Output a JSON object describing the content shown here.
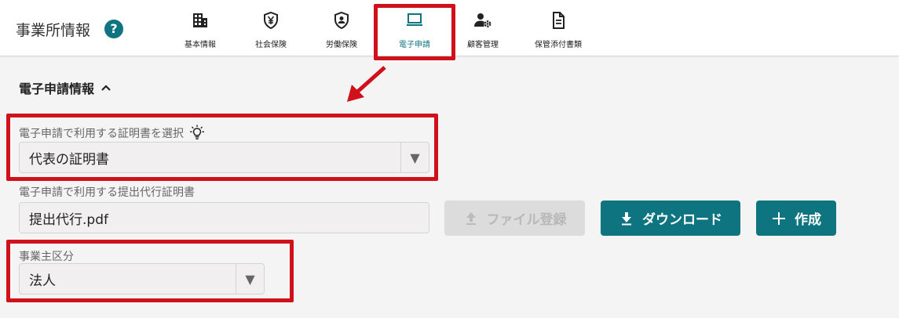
{
  "header": {
    "title": "事業所情報",
    "help": "?",
    "tabs": [
      {
        "label": "基本情報",
        "icon": "building-icon"
      },
      {
        "label": "社会保険",
        "icon": "yen-shield-icon"
      },
      {
        "label": "労働保険",
        "icon": "person-shield-icon"
      },
      {
        "label": "電子申請",
        "icon": "laptop-icon",
        "active": true
      },
      {
        "label": "顧客管理",
        "icon": "user-gear-icon"
      },
      {
        "label": "保管添付書類",
        "icon": "document-icon"
      }
    ]
  },
  "section": {
    "title": "電子申請情報",
    "certificate": {
      "label": "電子申請で利用する証明書を選択",
      "value": "代表の証明書"
    },
    "proxy_certificate": {
      "label": "電子申請で利用する提出代行証明書",
      "value": "提出代行.pdf"
    },
    "business_type": {
      "label": "事業主区分",
      "value": "法人"
    }
  },
  "buttons": {
    "upload": "ファイル登録",
    "download": "ダウンロード",
    "create": "作成"
  },
  "colors": {
    "accent": "#0e7480",
    "highlight": "#d0101b"
  }
}
